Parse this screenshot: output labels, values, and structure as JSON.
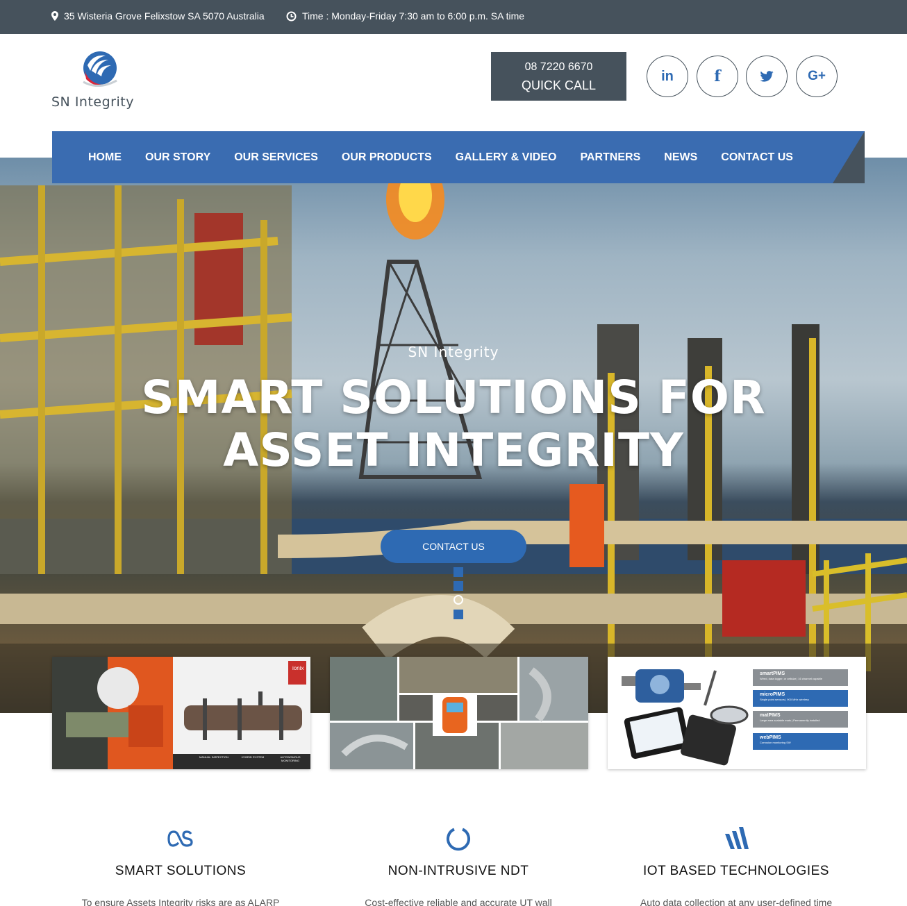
{
  "topbar": {
    "address": "35 Wisteria Grove Felixstow SA 5070 Australia",
    "hours": "Time : Monday-Friday 7:30 am to 6:00 p.m. SA time",
    "icons": [
      "map-pin-icon",
      "clock-icon"
    ]
  },
  "brand": {
    "name": "SN Integrity"
  },
  "header": {
    "phone": "08 7220 6670",
    "quick_call": "QUICK CALL",
    "social": [
      {
        "label": "in",
        "icon": "linkedin-icon"
      },
      {
        "label": "f",
        "icon": "facebook-icon"
      },
      {
        "label": "twitter",
        "icon": "twitter-icon"
      },
      {
        "label": "G+",
        "icon": "google-plus-icon"
      }
    ]
  },
  "nav": {
    "items": [
      "HOME",
      "OUR STORY",
      "OUR SERVICES",
      "OUR PRODUCTS",
      "GALLERY & VIDEO",
      "PARTNERS",
      "NEWS",
      "CONTACT US"
    ]
  },
  "hero": {
    "subtitle": "SN Integrity",
    "title_line1": "SMART SOLUTIONS FOR",
    "title_line2": "ASSET INTEGRITY",
    "button": "CONTACT US",
    "slides": 4,
    "active_slide": 3
  },
  "cards": {
    "card1": {
      "logo": "ionix",
      "captions": [
        "MANUAL INSPECTION",
        "HYBRID SYSTEM",
        "AUTONOMOUS MONITORING"
      ]
    },
    "card3": {
      "products": [
        {
          "name": "smartPIMS",
          "desc": "Wired, data logger, or cellular | 16 channel capable",
          "color": "#8a8f94"
        },
        {
          "name": "microPIMS",
          "desc": "Single point sensors | 900 MHz wireless",
          "color": "#2e6ab3"
        },
        {
          "name": "matPIMS",
          "desc": "Large area scalable mats | Permanently installed",
          "color": "#8a8f94"
        },
        {
          "name": "webPIMS",
          "desc": "Corrosion monitoring SW",
          "color": "#2e6ab3"
        }
      ]
    }
  },
  "features": [
    {
      "icon": "lastfm-icon",
      "title": "SMART SOLUTIONS",
      "text": "To ensure Assets Integrity risks are as ALARP"
    },
    {
      "icon": "circle-notch-icon",
      "title": "NON-INTRUSIVE NDT",
      "text": "Cost-effective reliable and accurate UT wall"
    },
    {
      "icon": "wave-bars-icon",
      "title": "IOT BASED TECHNOLOGIES",
      "text": "Auto data collection at any user-defined time"
    }
  ],
  "colors": {
    "primary": "#3a6cb1",
    "dark": "#46525c",
    "accent_red": "#d9263a"
  }
}
